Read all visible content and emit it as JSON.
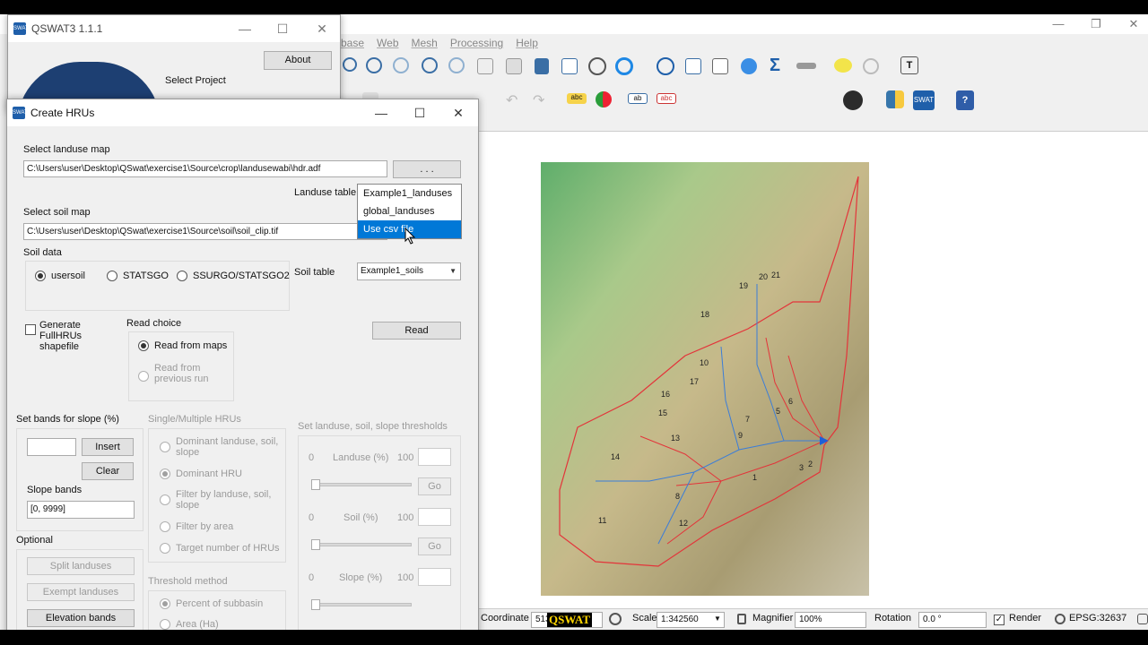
{
  "qgis": {
    "menu": [
      "base",
      "Web",
      "Mesh",
      "Processing",
      "Help"
    ],
    "map_labels": [
      "19",
      "20",
      "21",
      "18",
      "10",
      "17",
      "16",
      "6",
      "15",
      "5",
      "7",
      "13",
      "9",
      "14",
      "3",
      "2",
      "1",
      "8",
      "12",
      "11"
    ],
    "statusbar": {
      "coordinate_label": "Coordinate",
      "coordinate_value": "513",
      "scale_label": "Scale",
      "scale_value": "1:342560",
      "magnifier_label": "Magnifier",
      "magnifier_value": "100%",
      "rotation_label": "Rotation",
      "rotation_value": "0.0 °",
      "render_label": "Render",
      "crs": "EPSG:32637"
    },
    "watermark": "QSWAT"
  },
  "qswat": {
    "title": "QSWAT3 1.1.1",
    "about_button": "About",
    "select_project": "Select Project"
  },
  "hru": {
    "title": "Create HRUs",
    "landuse_map_label": "Select landuse map",
    "landuse_map_path": "C:\\Users\\user\\Desktop\\QSwat\\exercise1\\Source\\crop\\landusewabi\\hdr.adf",
    "browse_button": ". . .",
    "landuse_table_label": "Landuse table",
    "landuse_table_options": [
      "Example1_landuses",
      "global_landuses",
      "Use csv file"
    ],
    "soil_map_label": "Select soil map",
    "soil_map_path": "C:\\Users\\user\\Desktop\\QSwat\\exercise1\\Source\\soil\\soil_clip.tif",
    "soil_data_label": "Soil data",
    "soil_options": [
      "usersoil",
      "STATSGO",
      "SSURGO/STATSGO2"
    ],
    "soil_table_label": "Soil table",
    "soil_table_value": "Example1_soils",
    "full_hrus_label": "Generate FullHRUs shapefile",
    "read_choice_label": "Read choice",
    "read_from_maps": "Read from maps",
    "read_from_previous": "Read from previous run",
    "read_button": "Read",
    "slope_bands_label": "Set bands for slope (%)",
    "insert_button": "Insert",
    "clear_button": "Clear",
    "slope_bands_sublabel": "Slope bands",
    "slope_bands_value": "[0, 9999]",
    "optional_label": "Optional",
    "split_landuses": "Split landuses",
    "exempt_landuses": "Exempt landuses",
    "elevation_bands": "Elevation bands",
    "single_multiple_label": "Single/Multiple HRUs",
    "hru_options": [
      "Dominant landuse, soil, slope",
      "Dominant HRU",
      "Filter by landuse, soil, slope",
      "Filter by area",
      "Target number of HRUs"
    ],
    "threshold_method_label": "Threshold method",
    "threshold_options": [
      "Percent of subbasin",
      "Area (Ha)"
    ],
    "thresholds_label": "Set landuse, soil, slope thresholds",
    "thresholds": [
      {
        "label": "Landuse (%)",
        "min": "0",
        "max": "100"
      },
      {
        "label": "Soil (%)",
        "min": "0",
        "max": "100"
      },
      {
        "label": "Slope (%)",
        "min": "0",
        "max": "100"
      }
    ],
    "go_button": "Go"
  }
}
